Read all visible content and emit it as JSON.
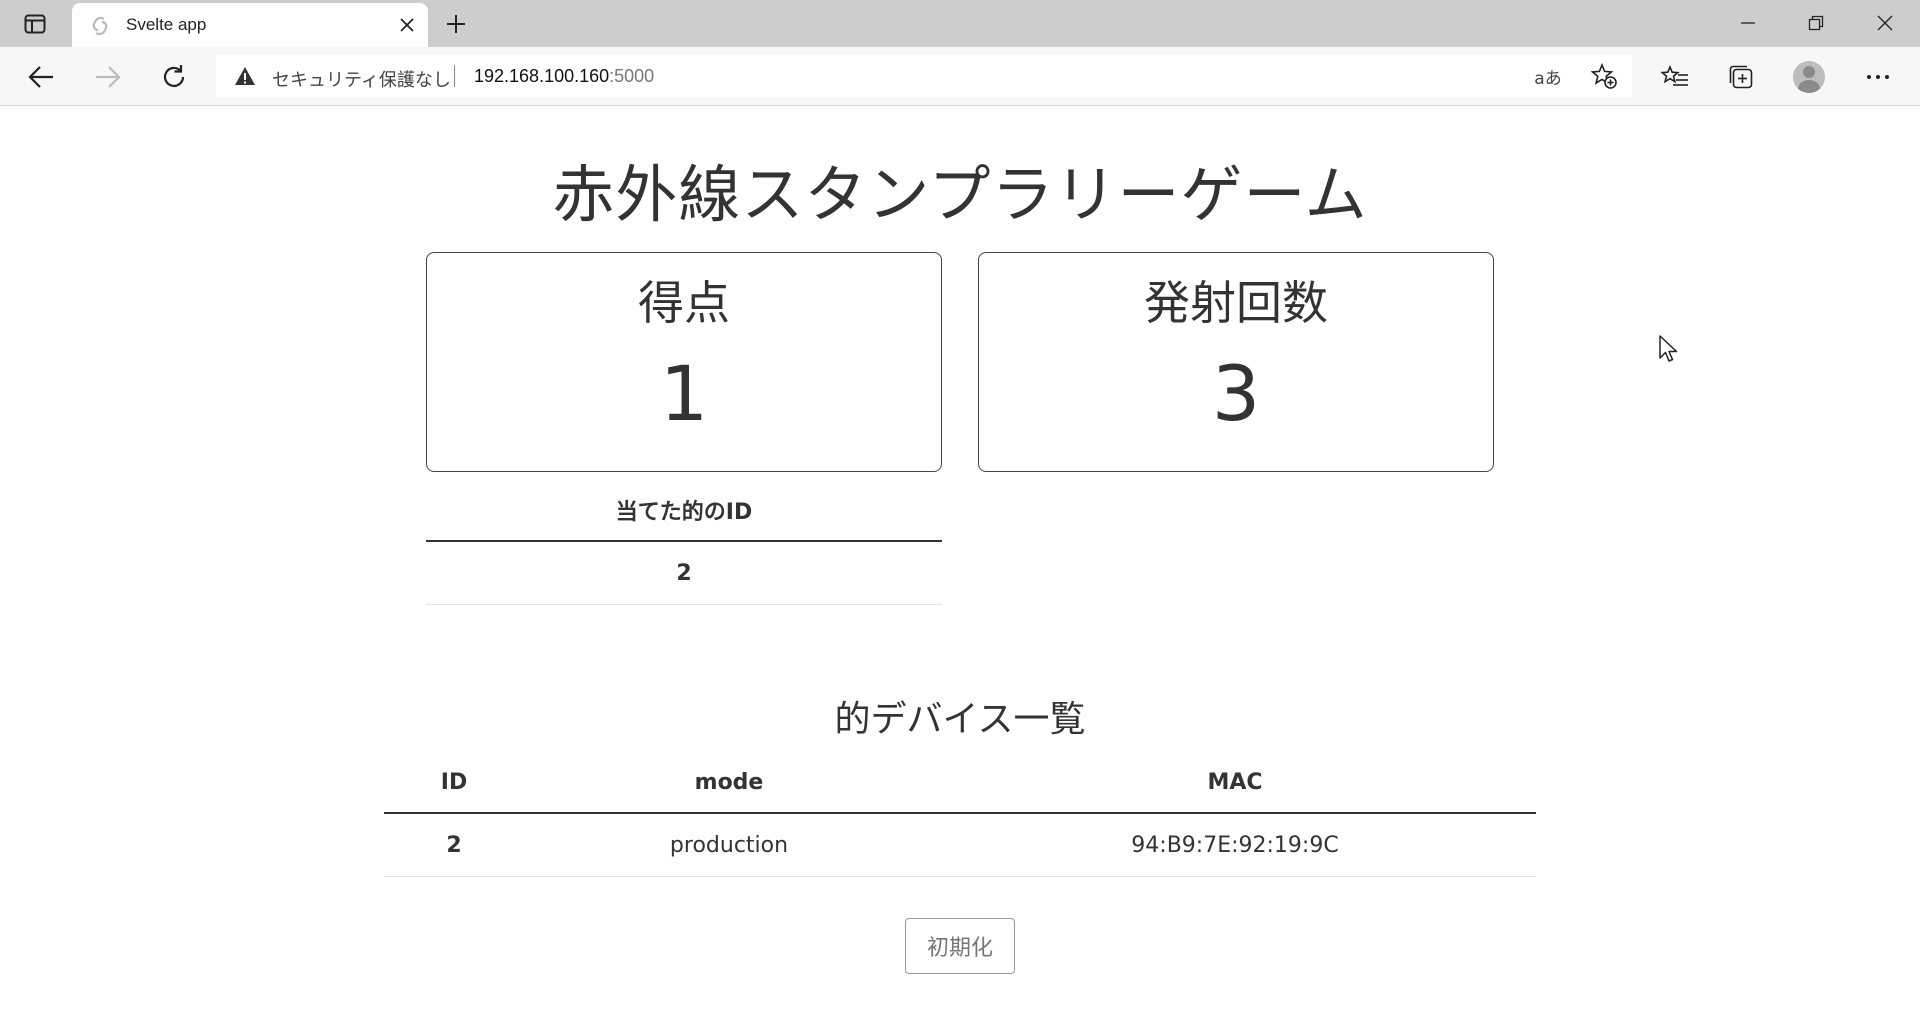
{
  "browser": {
    "tab_title": "Svelte app",
    "security_label": "セキュリティ保護なし",
    "url_host": "192.168.100.160",
    "url_port": ":5000",
    "read_aloud_label": "aあ"
  },
  "app": {
    "title": "赤外線スタンプラリーゲーム",
    "score": {
      "label": "得点",
      "value": "1"
    },
    "shots": {
      "label": "発射回数",
      "value": "3"
    },
    "hit_table": {
      "header": "当てた的のID",
      "rows": [
        "2"
      ]
    },
    "devices": {
      "title": "的デバイス一覧",
      "columns": [
        "ID",
        "mode",
        "MAC"
      ],
      "rows": [
        {
          "id": "2",
          "mode": "production",
          "mac": "94:B9:7E:92:19:9C"
        }
      ]
    },
    "reset_label": "初期化"
  }
}
